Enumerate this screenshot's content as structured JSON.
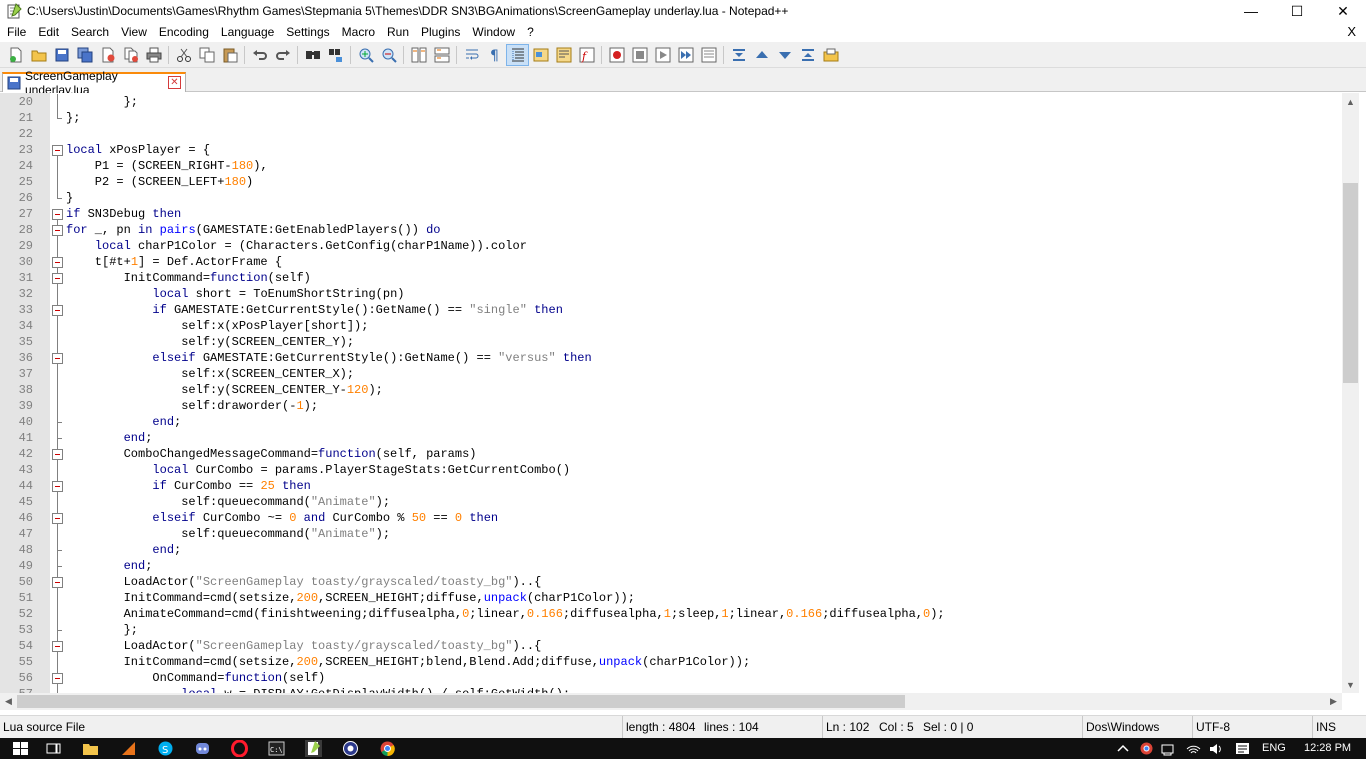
{
  "window": {
    "title": "C:\\Users\\Justin\\Documents\\Games\\Rhythm Games\\Stepmania 5\\Themes\\DDR SN3\\BGAnimations\\ScreenGameplay underlay.lua - Notepad++",
    "minimize": "—",
    "maximize": "☐",
    "close": "✕"
  },
  "menu": {
    "items": [
      "File",
      "Edit",
      "Search",
      "View",
      "Encoding",
      "Language",
      "Settings",
      "Macro",
      "Run",
      "Plugins",
      "Window",
      "?"
    ],
    "close_doc": "X"
  },
  "toolbar": {
    "buttons": [
      "new-file-icon",
      "open-file-icon",
      "save-icon",
      "save-all-icon",
      "close-icon",
      "close-all-icon",
      "print-icon",
      "cut-icon",
      "copy-icon",
      "paste-icon",
      "undo-icon",
      "redo-icon",
      "find-icon",
      "replace-icon",
      "zoom-in-icon",
      "zoom-out-icon",
      "sync-vertical-icon",
      "sync-horizontal-icon",
      "word-wrap-icon",
      "show-all-chars-icon",
      "indent-guide-icon",
      "user-language-icon",
      "doc-map-icon",
      "function-list-icon",
      "record-macro-icon",
      "stop-macro-icon",
      "play-macro-icon",
      "play-multiple-icon",
      "save-macro-icon",
      "folding-icon",
      "prev-bookmark-icon",
      "next-bookmark-icon",
      "bookmark-icon",
      "launch-icon"
    ]
  },
  "tabs": [
    {
      "label": "ScreenGameplay underlay.lua",
      "close": "✕"
    }
  ],
  "editor": {
    "lines": [
      {
        "n": "20",
        "fold": "line",
        "html": "        };"
      },
      {
        "n": "21",
        "fold": "end",
        "html": "};"
      },
      {
        "n": "22",
        "fold": "none",
        "html": ""
      },
      {
        "n": "23",
        "fold": "open",
        "html": "<span class='kw'>local</span> xPosPlayer = {"
      },
      {
        "n": "24",
        "fold": "line",
        "html": "    P1 = (SCREEN_RIGHT-<span class='num'>180</span>),"
      },
      {
        "n": "25",
        "fold": "line",
        "html": "    P2 = (SCREEN_LEFT+<span class='num'>180</span>)"
      },
      {
        "n": "26",
        "fold": "end",
        "html": "}"
      },
      {
        "n": "27",
        "fold": "open",
        "html": "<span class='kw'>if</span> SN3Debug <span class='kw'>then</span>"
      },
      {
        "n": "28",
        "fold": "open",
        "html": "<span class='kw'>for</span> _, pn <span class='kw'>in</span> <span class='kwb'>pairs</span>(GAMESTATE:GetEnabledPlayers()) <span class='kw'>do</span>"
      },
      {
        "n": "29",
        "fold": "line",
        "html": "    <span class='kw'>local</span> charP1Color = (Characters.GetConfig(charP1Name)).color"
      },
      {
        "n": "30",
        "fold": "open",
        "html": "    t[#t+<span class='num'>1</span>] = Def.ActorFrame {"
      },
      {
        "n": "31",
        "fold": "open",
        "html": "        InitCommand=<span class='kw'>function</span>(self)"
      },
      {
        "n": "32",
        "fold": "line",
        "html": "            <span class='kw'>local</span> short = ToEnumShortString(pn)"
      },
      {
        "n": "33",
        "fold": "open",
        "html": "            <span class='kw'>if</span> GAMESTATE:GetCurrentStyle():GetName() == <span class='str'>\"single\"</span> <span class='kw'>then</span>"
      },
      {
        "n": "34",
        "fold": "line",
        "html": "                self:x(xPosPlayer[short]);"
      },
      {
        "n": "35",
        "fold": "line",
        "html": "                self:y(SCREEN_CENTER_Y);"
      },
      {
        "n": "36",
        "fold": "open",
        "html": "            <span class='kw'>elseif</span> GAMESTATE:GetCurrentStyle():GetName() == <span class='str'>\"versus\"</span> <span class='kw'>then</span>"
      },
      {
        "n": "37",
        "fold": "line",
        "html": "                self:x(SCREEN_CENTER_X);"
      },
      {
        "n": "38",
        "fold": "line",
        "html": "                self:y(SCREEN_CENTER_Y-<span class='num'>120</span>);"
      },
      {
        "n": "39",
        "fold": "line",
        "html": "                self:draworder(-<span class='num'>1</span>);"
      },
      {
        "n": "40",
        "fold": "end",
        "html": "            <span class='kw'>end</span>;"
      },
      {
        "n": "41",
        "fold": "end",
        "html": "        <span class='kw'>end</span>;"
      },
      {
        "n": "42",
        "fold": "open",
        "html": "        ComboChangedMessageCommand=<span class='kw'>function</span>(self, params)"
      },
      {
        "n": "43",
        "fold": "line",
        "html": "            <span class='kw'>local</span> CurCombo = params.PlayerStageStats:GetCurrentCombo()"
      },
      {
        "n": "44",
        "fold": "open",
        "html": "            <span class='kw'>if</span> CurCombo == <span class='num'>25</span> <span class='kw'>then</span>"
      },
      {
        "n": "45",
        "fold": "line",
        "html": "                self:queuecommand(<span class='str'>\"Animate\"</span>);"
      },
      {
        "n": "46",
        "fold": "open",
        "html": "            <span class='kw'>elseif</span> CurCombo ~= <span class='num'>0</span> <span class='kw'>and</span> CurCombo % <span class='num'>50</span> == <span class='num'>0</span> <span class='kw'>then</span>"
      },
      {
        "n": "47",
        "fold": "line",
        "html": "                self:queuecommand(<span class='str'>\"Animate\"</span>);"
      },
      {
        "n": "48",
        "fold": "end",
        "html": "            <span class='kw'>end</span>;"
      },
      {
        "n": "49",
        "fold": "end",
        "html": "        <span class='kw'>end</span>;"
      },
      {
        "n": "50",
        "fold": "open",
        "html": "        LoadActor(<span class='str'>\"ScreenGameplay toasty/grayscaled/toasty_bg\"</span>)..{"
      },
      {
        "n": "51",
        "fold": "line",
        "html": "        InitCommand=cmd(setsize,<span class='num'>200</span>,SCREEN_HEIGHT;diffuse,<span class='kwb'>unpack</span>(charP1Color));"
      },
      {
        "n": "52",
        "fold": "line",
        "html": "        AnimateCommand=cmd(finishtweening;diffusealpha,<span class='num'>0</span>;linear,<span class='num'>0.166</span>;diffusealpha,<span class='num'>1</span>;sleep,<span class='num'>1</span>;linear,<span class='num'>0.166</span>;diffusealpha,<span class='num'>0</span>);"
      },
      {
        "n": "53",
        "fold": "end",
        "html": "        };"
      },
      {
        "n": "54",
        "fold": "open",
        "html": "        LoadActor(<span class='str'>\"ScreenGameplay toasty/grayscaled/toasty_bg\"</span>)..{"
      },
      {
        "n": "55",
        "fold": "line",
        "html": "        InitCommand=cmd(setsize,<span class='num'>200</span>,SCREEN_HEIGHT;blend,Blend.Add;diffuse,<span class='kwb'>unpack</span>(charP1Color));"
      },
      {
        "n": "56",
        "fold": "open",
        "html": "            OnCommand=<span class='kw'>function</span>(self)"
      },
      {
        "n": "57",
        "fold": "line",
        "html": "                <span class='kw'>local</span> w = DISPLAY:GetDisplayWidth() / self:GetWidth();"
      }
    ]
  },
  "scroll": {
    "vertical_position": 0.2,
    "horizontal_position": 0.0
  },
  "status": {
    "file_type": "Lua source File",
    "length": "length : 4804",
    "lines": "lines : 104",
    "ln": "Ln : 102",
    "col": "Col : 5",
    "sel": "Sel : 0 | 0",
    "eol": "Dos\\Windows",
    "encoding": "UTF-8",
    "mode": "INS"
  },
  "taskbar": {
    "language": "ENG",
    "time": "12:28 PM"
  },
  "colors": {
    "keyword": "#00008b",
    "builtin": "#0000ff",
    "string": "#808080",
    "number": "#ff8000",
    "active_tab_accent": "#fa8a0a"
  }
}
